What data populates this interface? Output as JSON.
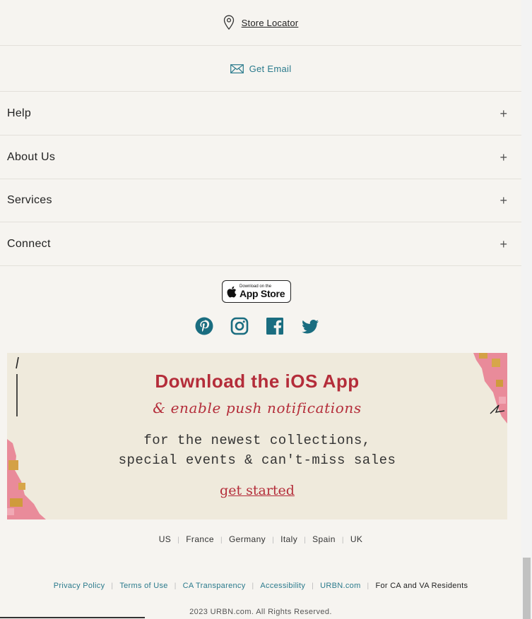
{
  "footer": {
    "store_locator": "Store Locator",
    "get_email": "Get Email",
    "accordion": [
      "Help",
      "About Us",
      "Services",
      "Connect"
    ],
    "app_store": {
      "small": "Download on the",
      "big": "App Store"
    },
    "social": [
      "pinterest-icon",
      "instagram-icon",
      "facebook-icon",
      "twitter-icon"
    ],
    "accent_color": "#1a6d80"
  },
  "banner": {
    "title": "Download the iOS App",
    "subtitle": "& enable push notifications",
    "body_line1": "for the newest collections,",
    "body_line2": "special events & can't-miss sales",
    "cta": "get started"
  },
  "regions": [
    "US",
    "France",
    "Germany",
    "Italy",
    "Spain",
    "UK"
  ],
  "legal": [
    "Privacy Policy",
    "Terms of Use",
    "CA Transparency",
    "Accessibility",
    "URBN.com",
    "For CA and VA Residents"
  ],
  "copyright": "2023 URBN.com. All Rights Reserved."
}
